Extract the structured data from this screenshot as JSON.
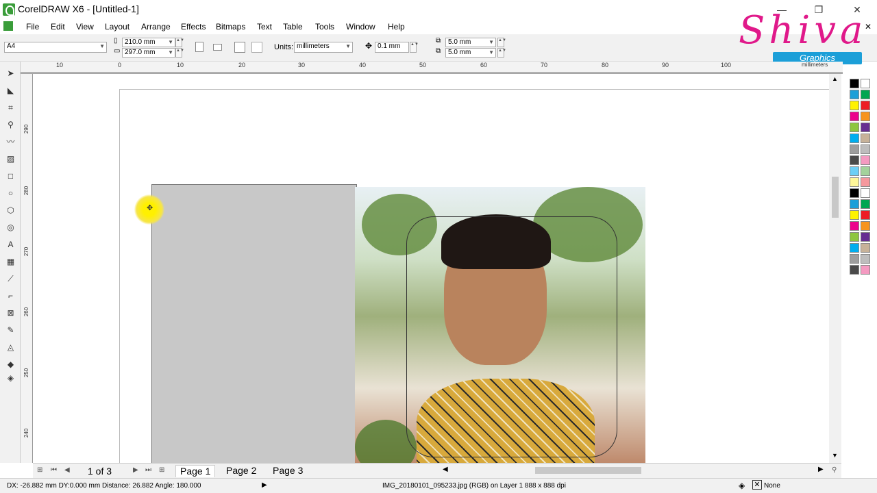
{
  "app": {
    "title": "CorelDRAW X6 - [Untitled-1]"
  },
  "window_controls": {
    "minimize": "—",
    "maximize": "❐",
    "close": "✕"
  },
  "menu": {
    "items": [
      "File",
      "Edit",
      "View",
      "Layout",
      "Arrange",
      "Effects",
      "Bitmaps",
      "Text",
      "Table",
      "Tools",
      "Window",
      "Help"
    ],
    "close_doc": "✕"
  },
  "property_bar": {
    "paper_size": "A4",
    "width": "210.0 mm",
    "height": "297.0 mm",
    "units_label": "Units:",
    "units_value": "millimeters",
    "nudge": "0.1 mm",
    "dup_x": "5.0 mm",
    "dup_y": "5.0 mm"
  },
  "rulers": {
    "top_ticks": [
      "10",
      "0",
      "10",
      "20",
      "30",
      "40",
      "50",
      "60",
      "70",
      "80",
      "90",
      "100"
    ],
    "top_unit": "millimeters",
    "left_ticks": [
      "290",
      "280",
      "270",
      "260",
      "250",
      "240"
    ],
    "left_unit": "millimeters"
  },
  "page_nav": {
    "count": "1 of 3",
    "tabs": [
      "Page 1",
      "Page 2",
      "Page 3"
    ]
  },
  "status": {
    "left": "DX: -26.882 mm DY:0.000 mm Distance: 26.882 Angle: 180.000",
    "center": "IMG_20180101_095233.jpg (RGB) on Layer 1 888 x 888 dpi",
    "fill_label": "None"
  },
  "brand": {
    "main": "Shiva",
    "sub": "Graphics"
  },
  "palette_colors": [
    "#000000",
    "#ffffff",
    "#1c9fd8",
    "#00a651",
    "#fff200",
    "#ed1c24",
    "#ec008c",
    "#f7941d",
    "#8dc63f",
    "#662d91",
    "#00aeef",
    "#c7b299",
    "#9e9e9e",
    "#bdbdbd",
    "#4a4a4a",
    "#f49ac1",
    "#6dcff6",
    "#a3d39c",
    "#fff799",
    "#f5989d"
  ]
}
